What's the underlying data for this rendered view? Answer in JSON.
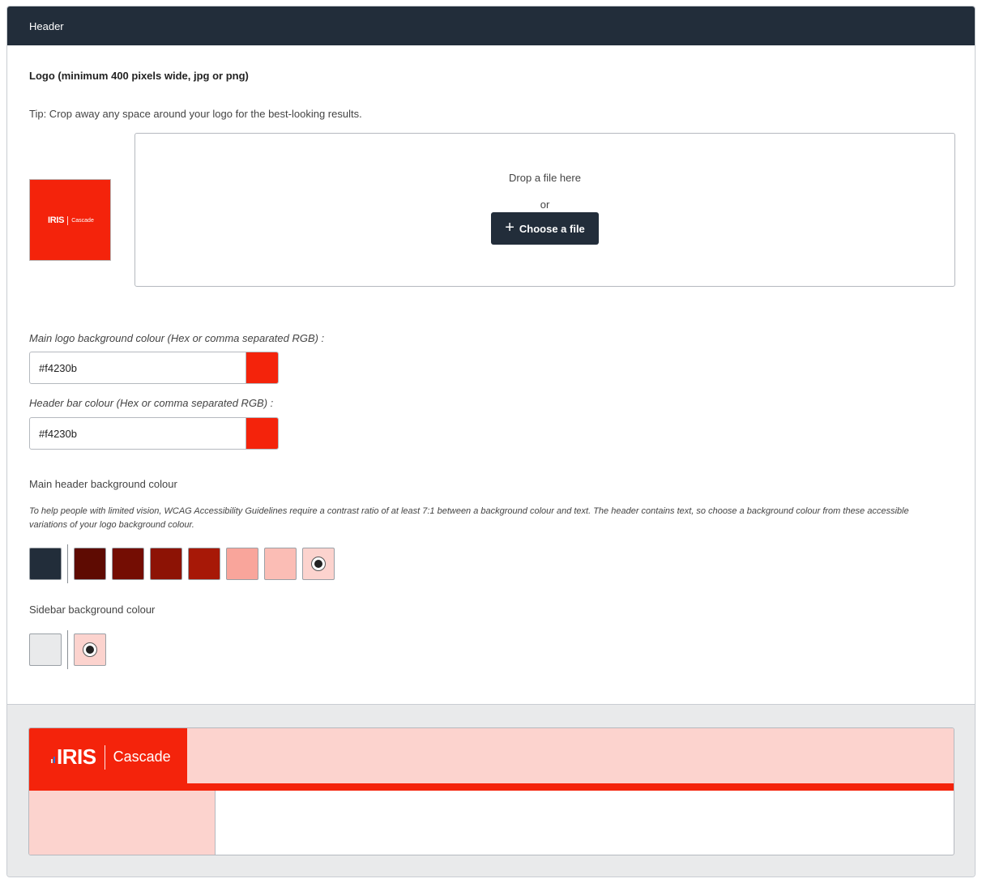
{
  "panel": {
    "title": "Header"
  },
  "logo": {
    "title": "Logo (minimum 400 pixels wide, jpg or png)",
    "tip": "Tip: Crop away any space around your logo for the best-looking results.",
    "brand": "IRIS",
    "product": "Cascade"
  },
  "dropzone": {
    "drop_text": "Drop a file here",
    "or_text": "or",
    "button_label": "Choose a file",
    "button_icon": "plus-icon"
  },
  "fields": {
    "logo_bg": {
      "label": "Main logo background colour (Hex or comma separated RGB) :",
      "value": "#f4230b",
      "color": "#f4230b"
    },
    "header_bar": {
      "label": "Header bar colour (Hex or comma separated RGB) :",
      "value": "#f4230b",
      "color": "#f4230b"
    }
  },
  "main_header": {
    "label": "Main header background colour",
    "help": "To help people with limited vision, WCAG Accessibility Guidelines require a contrast ratio of at least 7:1 between a background colour and text. The header contains text, so choose a background colour from these accessible variations of your logo background colour.",
    "default_swatch": "#222d3a",
    "swatches": [
      "#5e0b02",
      "#740d03",
      "#8d1305",
      "#a71807",
      "#f9a59b",
      "#fbbdb5",
      "#fcd3ce"
    ],
    "selected_index": 6
  },
  "sidebar": {
    "label": "Sidebar background colour",
    "default_swatch": "#e9eaeb",
    "swatches": [
      "#fcd3ce"
    ],
    "selected_index": 0
  },
  "preview": {
    "logo_bg": "#f4230b",
    "header_bg": "#fcd3ce",
    "bar_color": "#f4230b",
    "sidebar_bg": "#fcd3ce",
    "brand": "IRIS",
    "product": "Cascade"
  }
}
